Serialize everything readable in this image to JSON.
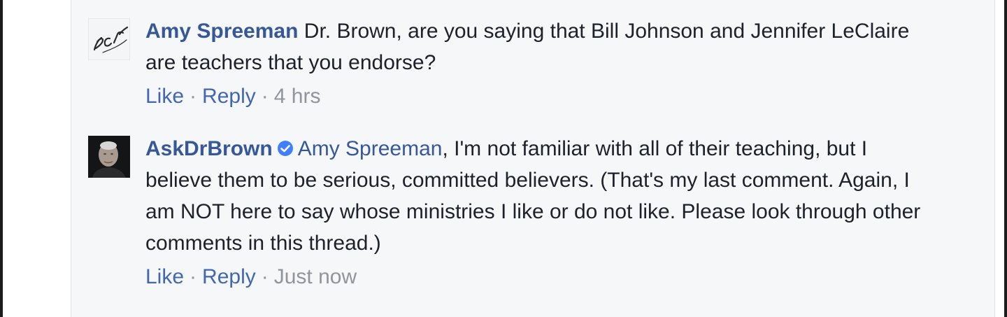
{
  "comments": [
    {
      "author": "Amy Spreeman",
      "avatar": "dcr-logo-avatar",
      "verified": false,
      "text": "Dr. Brown, are you saying that Bill Johnson and Jennifer LeClaire are teachers that you endorse?",
      "actions": {
        "like_label": "Like",
        "reply_label": "Reply",
        "timestamp": "4 hrs"
      }
    },
    {
      "author": "AskDrBrown",
      "avatar": "profile-photo-avatar",
      "verified": true,
      "mention": "Amy Spreeman",
      "text": ", I'm not familiar with all of their teaching, but I believe them to be serious, committed believers. (That's my last comment. Again, I am NOT here to say whose ministries I like or do not like. Please look through other comments in this thread.)",
      "actions": {
        "like_label": "Like",
        "reply_label": "Reply",
        "timestamp": "Just now"
      }
    }
  ],
  "colors": {
    "author_link": "#365899",
    "action_link": "#4267b2",
    "meta_gray": "#90949c",
    "thread_background": "#f6f7f9",
    "verified_badge": "#4080ff"
  }
}
